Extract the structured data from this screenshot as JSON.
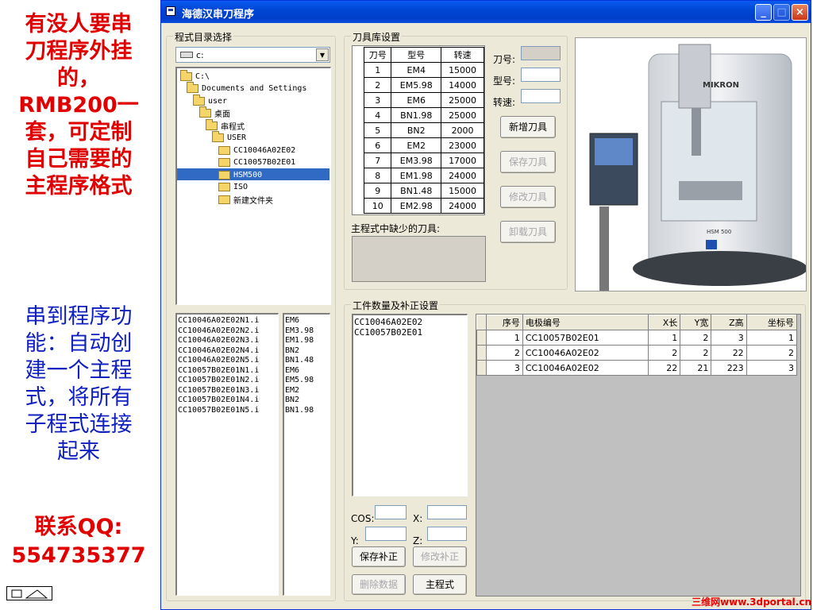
{
  "promo": {
    "lines_top": [
      "有没人要串",
      "刀程序外挂",
      "的，",
      "RMB200一",
      "套，可定制",
      "自己需要的",
      "主程序格式"
    ],
    "lines_mid": [
      "串到程序功",
      "能：自动创",
      "建一个主程",
      "式，将所有",
      "子程式连接",
      "起来"
    ],
    "contact_label": "联系QQ:",
    "contact_qq": "554735377"
  },
  "window": {
    "title": "海德汉串刀程序",
    "min_label": "_",
    "max_label": "□",
    "close_label": "×"
  },
  "dir_group": {
    "title": "程式目录选择",
    "drive": "c:",
    "tree": [
      {
        "label": "C:\\",
        "level": 0,
        "open": true
      },
      {
        "label": "Documents and Settings",
        "level": 1,
        "open": true
      },
      {
        "label": "user",
        "level": 2,
        "open": true
      },
      {
        "label": "桌面",
        "level": 3,
        "open": true
      },
      {
        "label": "串程式",
        "level": 4,
        "open": true
      },
      {
        "label": "USER",
        "level": 5,
        "open": true
      },
      {
        "label": "CC10046A02E02",
        "level": 6,
        "open": false
      },
      {
        "label": "CC10057B02E01",
        "level": 6,
        "open": false
      },
      {
        "label": "HSM500",
        "level": 6,
        "open": false,
        "selected": true
      },
      {
        "label": "ISO",
        "level": 6,
        "open": false
      },
      {
        "label": "新建文件夹",
        "level": 6,
        "open": false
      }
    ],
    "files": [
      "CC10046A02E02N1.i",
      "CC10046A02E02N2.i",
      "CC10046A02E02N3.i",
      "CC10046A02E02N4.i",
      "CC10046A02E02N5.i",
      "CC10057B02E01N1.i",
      "CC10057B02E01N2.i",
      "CC10057B02E01N3.i",
      "CC10057B02E01N4.i",
      "CC10057B02E01N5.i"
    ],
    "tools": [
      "EM6",
      "EM3.98",
      "EM1.98",
      "BN2",
      "BN1.48",
      "EM6",
      "EM5.98",
      "EM2",
      "BN2",
      "BN1.98"
    ]
  },
  "tool_group": {
    "title": "刀具库设置",
    "headers": [
      "刀号",
      "型号",
      "转速"
    ],
    "rows": [
      [
        "1",
        "EM4",
        "15000"
      ],
      [
        "2",
        "EM5.98",
        "14000"
      ],
      [
        "3",
        "EM6",
        "25000"
      ],
      [
        "4",
        "BN1.98",
        "25000"
      ],
      [
        "5",
        "BN2",
        "2000"
      ],
      [
        "6",
        "EM2",
        "23000"
      ],
      [
        "7",
        "EM3.98",
        "17000"
      ],
      [
        "8",
        "EM1.98",
        "24000"
      ],
      [
        "9",
        "BN1.48",
        "15000"
      ],
      [
        "10",
        "EM2.98",
        "24000"
      ]
    ],
    "label_no": "刀号:",
    "label_type": "型号:",
    "label_speed": "转速:",
    "btn_add": "新增刀具",
    "btn_save": "保存刀具",
    "btn_edit": "修改刀具",
    "btn_unload": "卸载刀具",
    "missing_label": "主程式中缺少的刀具:"
  },
  "workpiece_group": {
    "title": "工件数量及补正设置",
    "list": [
      "CC10046A02E02",
      "CC10057B02E01"
    ],
    "cos_label": "COS:",
    "x_label": "X:",
    "y_label": "Y:",
    "z_label": "Z:",
    "btn_save": "保存补正",
    "btn_edit": "修改补正",
    "btn_delete": "删除数据",
    "btn_main": "主程式",
    "headers": [
      "序号",
      "电极编号",
      "X长",
      "Y宽",
      "Z高",
      "坐标号"
    ],
    "rows": [
      [
        "1",
        "CC10057B02E01",
        "1",
        "2",
        "3",
        "1"
      ],
      [
        "2",
        "CC10046A02E02",
        "2",
        "2",
        "22",
        "2"
      ],
      [
        "3",
        "CC10046A02E02",
        "22",
        "21",
        "223",
        "3"
      ]
    ]
  },
  "machine": {
    "brand": "MIKRON",
    "model": "HSM 500"
  },
  "watermark": "三维网www.3dportal.cn"
}
